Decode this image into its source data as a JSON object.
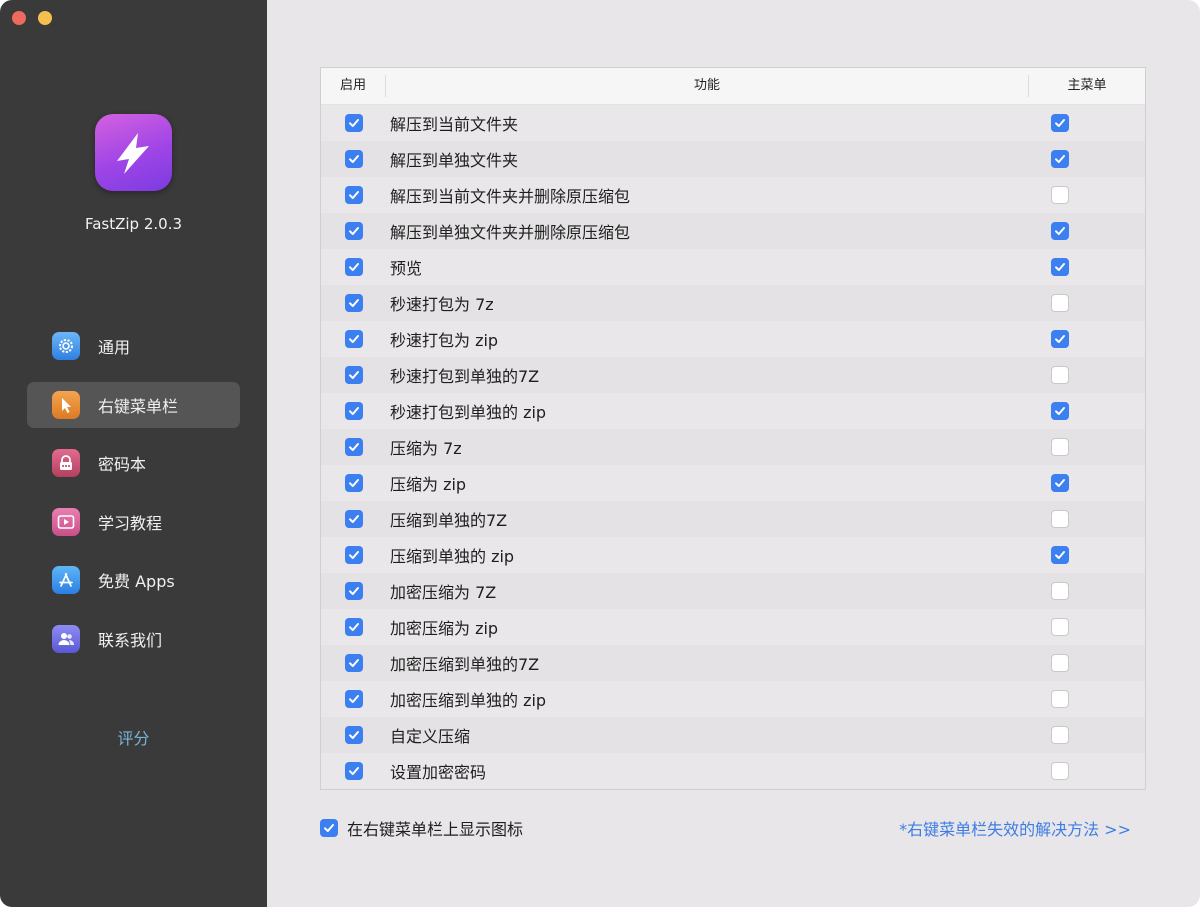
{
  "app": {
    "version_label": "FastZip 2.0.3",
    "rate_label": "评分"
  },
  "colors": {
    "sidebar_bg": "#3a3a3a",
    "accent": "#3b7ff0",
    "link": "#3d7de6"
  },
  "nav": {
    "items": [
      {
        "label": "通用",
        "icon": "gear-icon",
        "active": false
      },
      {
        "label": "右键菜单栏",
        "icon": "cursor-icon",
        "active": true
      },
      {
        "label": "密码本",
        "icon": "lock-icon",
        "active": false
      },
      {
        "label": "学习教程",
        "icon": "video-icon",
        "active": false
      },
      {
        "label": "免费 Apps",
        "icon": "app-store-icon",
        "active": false
      },
      {
        "label": "联系我们",
        "icon": "contacts-icon",
        "active": false
      }
    ]
  },
  "table": {
    "headers": {
      "enable": "启用",
      "function": "功能",
      "main_menu": "主菜单"
    },
    "rows": [
      {
        "label": "解压到当前文件夹",
        "enabled": true,
        "main_menu": true
      },
      {
        "label": "解压到单独文件夹",
        "enabled": true,
        "main_menu": true
      },
      {
        "label": "解压到当前文件夹并删除原压缩包",
        "enabled": true,
        "main_menu": false
      },
      {
        "label": "解压到单独文件夹并删除原压缩包",
        "enabled": true,
        "main_menu": true
      },
      {
        "label": "预览",
        "enabled": true,
        "main_menu": true
      },
      {
        "label": "秒速打包为 7z",
        "enabled": true,
        "main_menu": false
      },
      {
        "label": "秒速打包为 zip",
        "enabled": true,
        "main_menu": true
      },
      {
        "label": "秒速打包到单独的7Z",
        "enabled": true,
        "main_menu": false
      },
      {
        "label": "秒速打包到单独的 zip",
        "enabled": true,
        "main_menu": true
      },
      {
        "label": "压缩为 7z",
        "enabled": true,
        "main_menu": false
      },
      {
        "label": "压缩为 zip",
        "enabled": true,
        "main_menu": true
      },
      {
        "label": "压缩到单独的7Z",
        "enabled": true,
        "main_menu": false
      },
      {
        "label": "压缩到单独的 zip",
        "enabled": true,
        "main_menu": true
      },
      {
        "label": "加密压缩为 7Z",
        "enabled": true,
        "main_menu": false
      },
      {
        "label": "加密压缩为 zip",
        "enabled": true,
        "main_menu": false
      },
      {
        "label": "加密压缩到单独的7Z",
        "enabled": true,
        "main_menu": false
      },
      {
        "label": "加密压缩到单独的 zip",
        "enabled": true,
        "main_menu": false
      },
      {
        "label": "自定义压缩",
        "enabled": true,
        "main_menu": false
      },
      {
        "label": "设置加密密码",
        "enabled": true,
        "main_menu": false
      }
    ]
  },
  "footer": {
    "show_icon_label": "在右键菜单栏上显示图标",
    "show_icon_checked": true,
    "help_link": "*右键菜单栏失效的解决方法 >>"
  }
}
